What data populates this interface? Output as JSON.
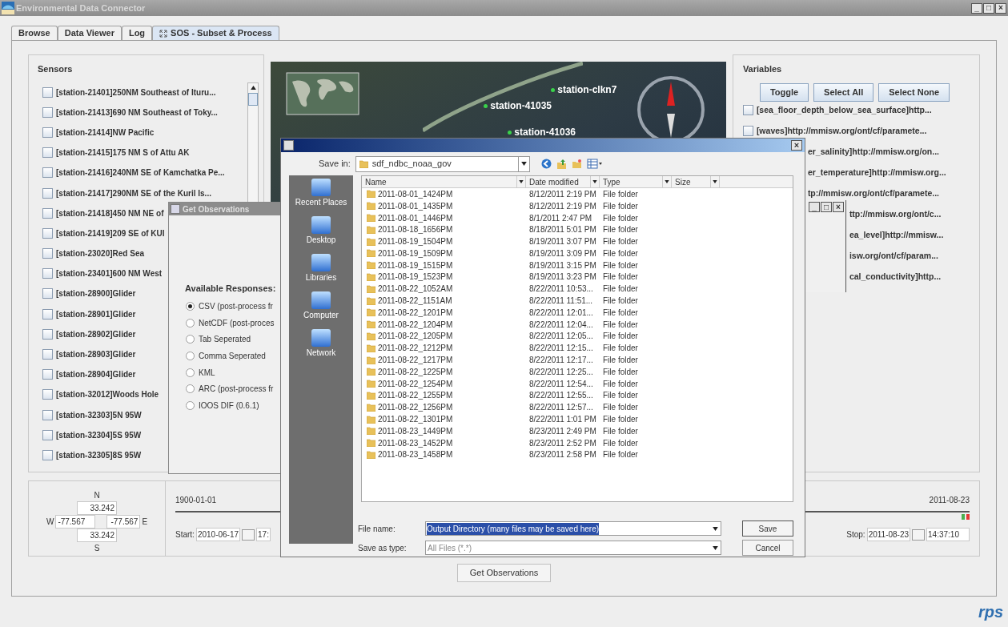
{
  "window": {
    "title": "Environmental Data Connector",
    "controls": [
      "_",
      "□",
      "×"
    ]
  },
  "tabs": [
    {
      "label": "Browse",
      "selected": false,
      "kind": "plain"
    },
    {
      "label": "Data Viewer",
      "selected": false,
      "kind": "plain"
    },
    {
      "label": "Log",
      "selected": false,
      "kind": "plain"
    },
    {
      "label": "SOS - Subset & Process",
      "selected": true,
      "kind": "closable"
    }
  ],
  "sensors": {
    "title": "Sensors",
    "items": [
      {
        "label": "[station-21401]250NM Southeast of Ituru...",
        "checked": false
      },
      {
        "label": "[station-21413]690 NM Southeast of Toky...",
        "checked": false
      },
      {
        "label": "[station-21414]NW Pacific",
        "checked": false
      },
      {
        "label": "[station-21415]175 NM S of Attu AK",
        "checked": false
      },
      {
        "label": "[station-21416]240NM SE of Kamchatka Pe...",
        "checked": false
      },
      {
        "label": "[station-21417]290NM SE of the Kuril Is...",
        "checked": false
      },
      {
        "label": "[station-21418]450 NM NE of",
        "checked": false
      },
      {
        "label": "[station-21419]209 SE of KUI",
        "checked": false
      },
      {
        "label": "[station-23020]Red Sea",
        "checked": false
      },
      {
        "label": "[station-23401]600 NM West",
        "checked": false
      },
      {
        "label": "[station-28900]Glider",
        "checked": false
      },
      {
        "label": "[station-28901]Glider",
        "checked": false
      },
      {
        "label": "[station-28902]Glider",
        "checked": false
      },
      {
        "label": "[station-28903]Glider",
        "checked": false
      },
      {
        "label": "[station-28904]Glider",
        "checked": false
      },
      {
        "label": "[station-32012]Woods Hole",
        "checked": false
      },
      {
        "label": "[station-32303]5N 95W",
        "checked": false
      },
      {
        "label": "[station-32304]5S 95W",
        "checked": false
      },
      {
        "label": "[station-32305]8S 95W",
        "checked": false
      }
    ]
  },
  "map": {
    "stations": [
      "station-clkn7",
      "station-41035",
      "station-41036"
    ]
  },
  "variables": {
    "title": "Variables",
    "buttons": [
      "Toggle",
      "Select All",
      "Select None"
    ],
    "items": [
      {
        "label": "[sea_floor_depth_below_sea_surface]http...",
        "checked": false,
        "kind": "full"
      },
      {
        "label": "[waves]http://mmisw.org/ont/cf/paramete...",
        "checked": false,
        "kind": "full"
      },
      {
        "label": "er_salinity]http://mmisw.org/on...",
        "kind": "covered"
      },
      {
        "label": "er_temperature]http://mmisw.org...",
        "kind": "covered"
      },
      {
        "label": "tp://mmisw.org/ont/cf/paramete...",
        "kind": "covered"
      },
      {
        "label": "ttp://mmisw.org/ont/c...",
        "kind": "covered_more"
      },
      {
        "label": "ea_level]http://mmisw...",
        "kind": "covered_more"
      },
      {
        "label": "isw.org/ont/cf/param...",
        "kind": "covered_more"
      },
      {
        "label": "cal_conductivity]http...",
        "kind": "covered_more"
      }
    ]
  },
  "bounds": {
    "n_label": "N",
    "s_label": "S",
    "w_label": "W",
    "e_label": "E",
    "north": "33.242",
    "south": "33.242",
    "west": "-77.567",
    "east": "-77.567"
  },
  "time_range": {
    "min": "1900-01-01",
    "max": "2011-08-23",
    "start_label": "Start:",
    "start_date": "2010-06-17",
    "start_time": "17:",
    "stop_label": "Stop:",
    "stop_date": "2011-08-23",
    "stop_time": "14:37:10"
  },
  "get_observations_button": "Get Observations",
  "logo": "rps",
  "get_observations_dialog": {
    "title": "Get Observations",
    "group": "Available Responses:",
    "options": [
      {
        "label": "CSV (post-process fr",
        "selected": true
      },
      {
        "label": "NetCDF (post-proces",
        "selected": false
      },
      {
        "label": "Tab Seperated",
        "selected": false
      },
      {
        "label": "Comma Seperated",
        "selected": false
      },
      {
        "label": "KML",
        "selected": false
      },
      {
        "label": "ARC (post-process fr",
        "selected": false
      },
      {
        "label": "IOOS DIF (0.6.1)",
        "selected": false
      }
    ]
  },
  "save_dialog": {
    "close": "×",
    "save_in_label": "Save in:",
    "save_in": "sdf_ndbc_noaa_gov",
    "places": [
      "Recent Places",
      "Desktop",
      "Libraries",
      "Computer",
      "Network"
    ],
    "columns": [
      "Name",
      "Date modified",
      "Type",
      "Size"
    ],
    "rows": [
      {
        "name": "2011-08-01_1424PM",
        "date": "8/12/2011 2:19 PM",
        "type": "File folder"
      },
      {
        "name": "2011-08-01_1435PM",
        "date": "8/12/2011 2:19 PM",
        "type": "File folder"
      },
      {
        "name": "2011-08-01_1446PM",
        "date": "8/1/2011 2:47 PM",
        "type": "File folder"
      },
      {
        "name": "2011-08-18_1656PM",
        "date": "8/18/2011 5:01 PM",
        "type": "File folder"
      },
      {
        "name": "2011-08-19_1504PM",
        "date": "8/19/2011 3:07 PM",
        "type": "File folder"
      },
      {
        "name": "2011-08-19_1509PM",
        "date": "8/19/2011 3:09 PM",
        "type": "File folder"
      },
      {
        "name": "2011-08-19_1515PM",
        "date": "8/19/2011 3:15 PM",
        "type": "File folder"
      },
      {
        "name": "2011-08-19_1523PM",
        "date": "8/19/2011 3:23 PM",
        "type": "File folder"
      },
      {
        "name": "2011-08-22_1052AM",
        "date": "8/22/2011 10:53...",
        "type": "File folder"
      },
      {
        "name": "2011-08-22_1151AM",
        "date": "8/22/2011 11:51...",
        "type": "File folder"
      },
      {
        "name": "2011-08-22_1201PM",
        "date": "8/22/2011 12:01...",
        "type": "File folder"
      },
      {
        "name": "2011-08-22_1204PM",
        "date": "8/22/2011 12:04...",
        "type": "File folder"
      },
      {
        "name": "2011-08-22_1205PM",
        "date": "8/22/2011 12:05...",
        "type": "File folder"
      },
      {
        "name": "2011-08-22_1212PM",
        "date": "8/22/2011 12:15...",
        "type": "File folder"
      },
      {
        "name": "2011-08-22_1217PM",
        "date": "8/22/2011 12:17...",
        "type": "File folder"
      },
      {
        "name": "2011-08-22_1225PM",
        "date": "8/22/2011 12:25...",
        "type": "File folder"
      },
      {
        "name": "2011-08-22_1254PM",
        "date": "8/22/2011 12:54...",
        "type": "File folder"
      },
      {
        "name": "2011-08-22_1255PM",
        "date": "8/22/2011 12:55...",
        "type": "File folder"
      },
      {
        "name": "2011-08-22_1256PM",
        "date": "8/22/2011 12:57...",
        "type": "File folder"
      },
      {
        "name": "2011-08-22_1301PM",
        "date": "8/22/2011 1:01 PM",
        "type": "File folder"
      },
      {
        "name": "2011-08-23_1449PM",
        "date": "8/23/2011 2:49 PM",
        "type": "File folder"
      },
      {
        "name": "2011-08-23_1452PM",
        "date": "8/23/2011 2:52 PM",
        "type": "File folder"
      },
      {
        "name": "2011-08-23_1458PM",
        "date": "8/23/2011 2:58 PM",
        "type": "File folder"
      }
    ],
    "file_name_label": "File name:",
    "file_name": "Output Directory (many files may be saved here)",
    "type_label": "Save as type:",
    "type": "All Files (*.*)",
    "buttons": [
      "Save",
      "Cancel"
    ]
  },
  "small_window": {
    "controls": [
      "_",
      "□",
      "×"
    ]
  }
}
